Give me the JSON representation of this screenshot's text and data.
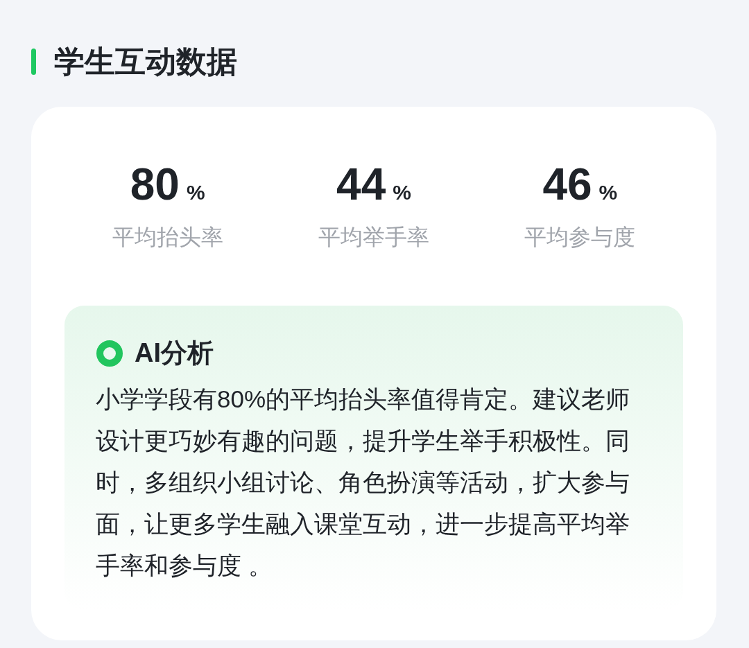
{
  "section_title": "学生互动数据",
  "stats": [
    {
      "value": "80",
      "unit": "%",
      "label": "平均抬头率"
    },
    {
      "value": "44",
      "unit": "%",
      "label": "平均举手率"
    },
    {
      "value": "46",
      "unit": "%",
      "label": "平均参与度"
    }
  ],
  "analysis": {
    "title": "AI分析",
    "text": "小学学段有80%的平均抬头率值得肯定。建议老师设计更巧妙有趣的问题，提升学生举手积极性。同时，多组织小组讨论、角色扮演等活动，扩大参与面，让更多学生融入课堂互动，进一步提高平均举手率和参与度 。"
  }
}
